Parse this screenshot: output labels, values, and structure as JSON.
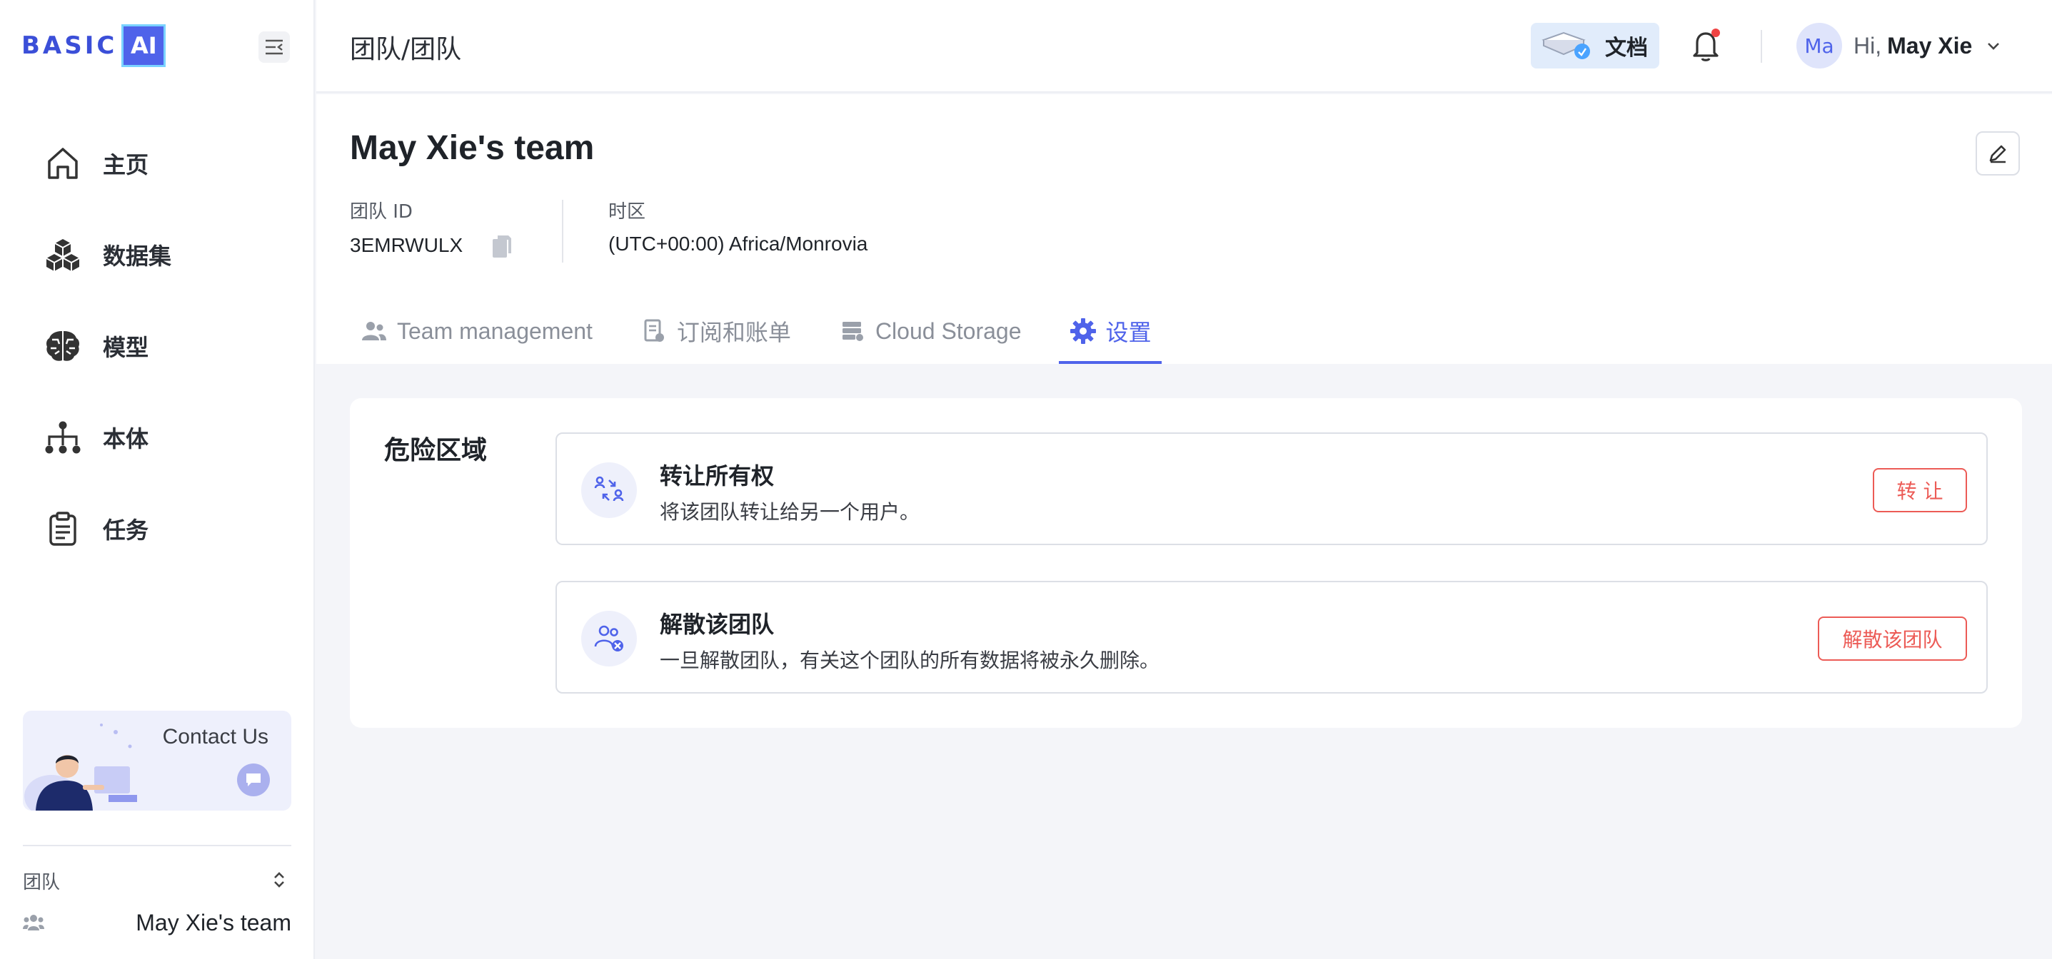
{
  "brand": {
    "logo_text": "BASIC",
    "logo_badge": "AI",
    "accent": "#4f63ea",
    "danger": "#ec5b56"
  },
  "sidebar": {
    "items": [
      {
        "label": "主页",
        "icon": "home-icon"
      },
      {
        "label": "数据集",
        "icon": "cubes-icon"
      },
      {
        "label": "模型",
        "icon": "brain-icon"
      },
      {
        "label": "本体",
        "icon": "hierarchy-icon"
      },
      {
        "label": "任务",
        "icon": "clipboard-icon"
      }
    ],
    "contact_label": "Contact Us",
    "team_caption": "团队",
    "team_name": "May Xie's team"
  },
  "topbar": {
    "breadcrumb": "团队/团队",
    "docs_label": "文档",
    "avatar_initials": "Ma",
    "greeting": "Hi,",
    "user_name": "May Xie"
  },
  "header": {
    "team_title": "May Xie's team",
    "team_id_label": "团队 ID",
    "team_id_value": "3EMRWULX",
    "timezone_label": "时区",
    "timezone_value": "(UTC+00:00) Africa/Monrovia"
  },
  "tabs": [
    {
      "label": "Team management",
      "icon": "team-icon",
      "active": false
    },
    {
      "label": "订阅和账单",
      "icon": "billing-icon",
      "active": false
    },
    {
      "label": "Cloud Storage",
      "icon": "storage-icon",
      "active": false
    },
    {
      "label": "设置",
      "icon": "gear-icon",
      "active": true
    }
  ],
  "danger_zone": {
    "title": "危险区域",
    "transfer": {
      "title": "转让所有权",
      "desc": "将该团队转让给另一个用户。",
      "button": "转 让"
    },
    "dissolve": {
      "title": "解散该团队",
      "desc": "一旦解散团队，有关这个团队的所有数据将被永久删除。",
      "button": "解散该团队"
    }
  }
}
